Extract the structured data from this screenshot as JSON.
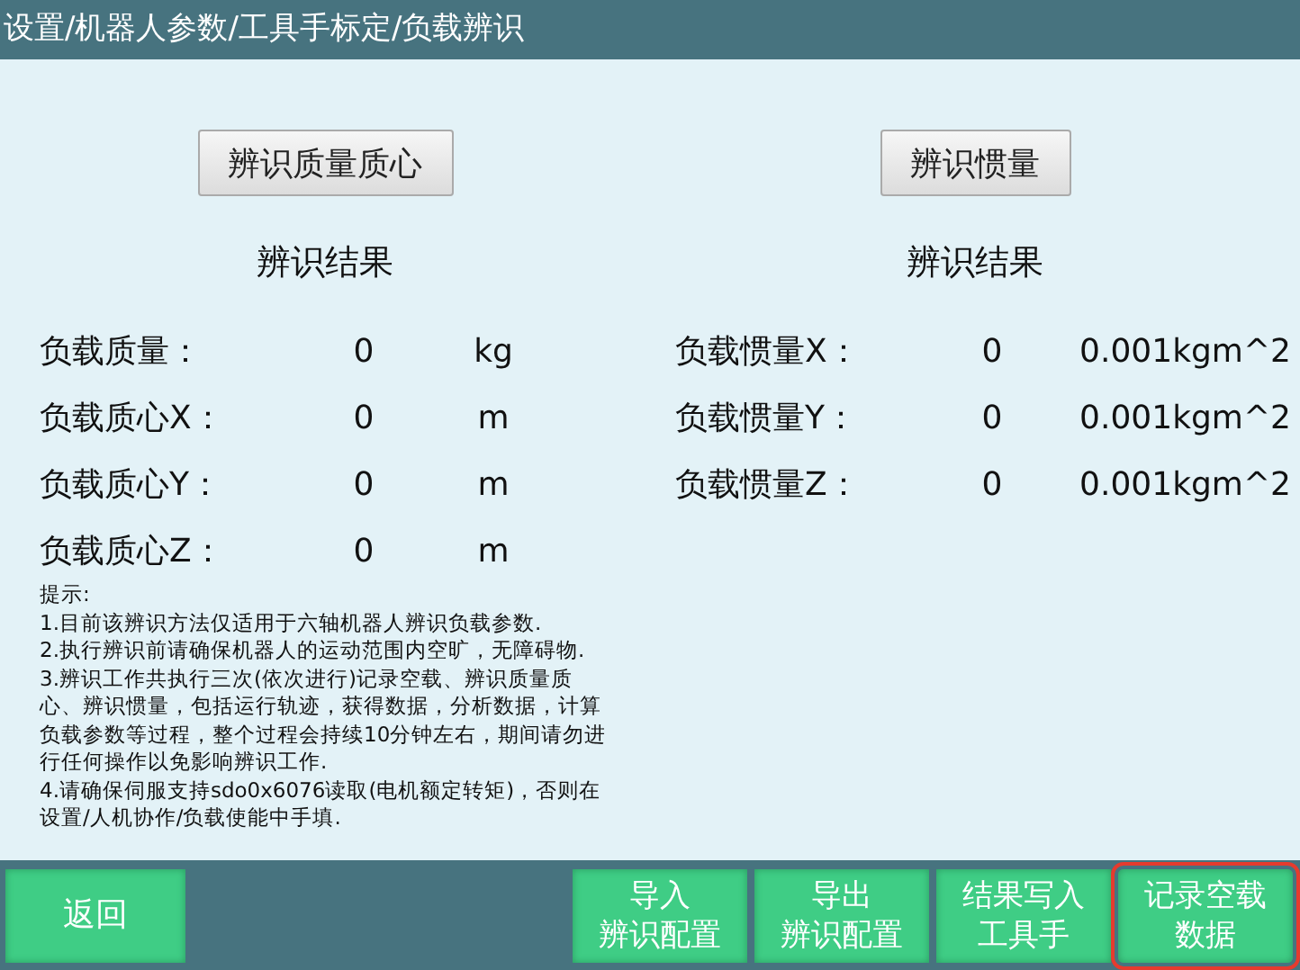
{
  "breadcrumb": "设置/机器人参数/工具手标定/负载辨识",
  "panels": [
    {
      "action": "辨识质量质心",
      "heading": "辨识结果",
      "rows": [
        {
          "label": "负载质量：",
          "value": "0",
          "unit": "kg"
        },
        {
          "label": "负载质心X：",
          "value": "0",
          "unit": "m"
        },
        {
          "label": "负载质心Y：",
          "value": "0",
          "unit": "m"
        },
        {
          "label": "负载质心Z：",
          "value": "0",
          "unit": "m"
        }
      ]
    },
    {
      "action": "辨识惯量",
      "heading": "辨识结果",
      "rows": [
        {
          "label": "负载惯量X：",
          "value": "0",
          "unit": "0.001kgm^2"
        },
        {
          "label": "负载惯量Y：",
          "value": "0",
          "unit": "0.001kgm^2"
        },
        {
          "label": "负载惯量Z：",
          "value": "0",
          "unit": "0.001kgm^2"
        }
      ]
    }
  ],
  "notes": [
    "提示:",
    "1.目前该辨识方法仅适用于六轴机器人辨识负载参数.",
    "2.执行辨识前请确保机器人的运动范围内空旷，无障碍物.",
    "3.辨识工作共执行三次(依次进行)记录空载、辨识质量质心、辨识惯量，包括运行轨迹，获得数据，分析数据，计算负载参数等过程，整个过程会持续10分钟左右，期间请勿进行任何操作以免影响辨识工作.",
    "4.请确保伺服支持sdo0x6076读取(电机额定转矩)，否则在设置/人机协作/负载使能中手填."
  ],
  "back_button": "返回",
  "buttons": [
    {
      "lines": [
        "导入",
        "辨识配置"
      ],
      "highlighted": false
    },
    {
      "lines": [
        "导出",
        "辨识配置"
      ],
      "highlighted": false
    },
    {
      "lines": [
        "结果写入",
        "工具手"
      ],
      "highlighted": false
    },
    {
      "lines": [
        "记录空载",
        "数据"
      ],
      "highlighted": true
    }
  ]
}
